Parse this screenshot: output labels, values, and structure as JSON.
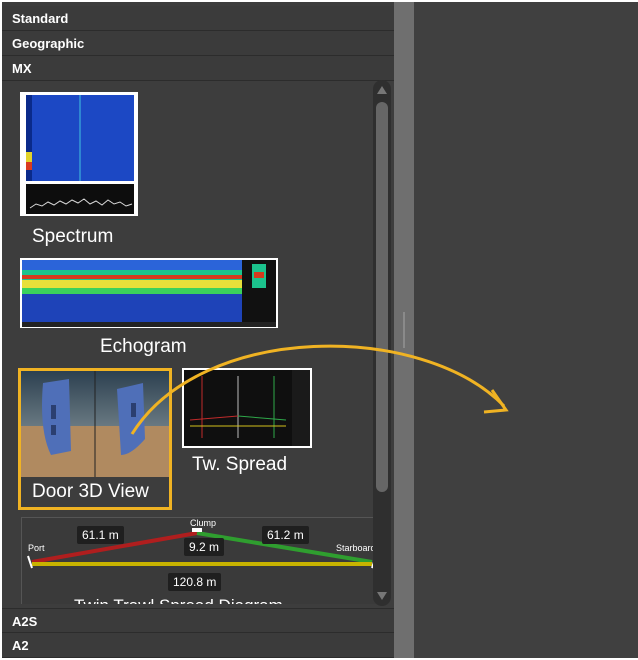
{
  "sections": {
    "standard": "Standard",
    "geographic": "Geographic",
    "mx": "MX",
    "a2s": "A2S",
    "a2": "A2"
  },
  "tiles": {
    "spectrum": "Spectrum",
    "echogram": "Echogram",
    "door3d": "Door 3D View",
    "tw_spread": "Tw. Spread",
    "twin_trawl": "Twin Trawl Spread Diagram"
  },
  "spread_diagram": {
    "port": "Port",
    "starboard": "Starboard",
    "clump": "Clump",
    "port_distance": "61.1 m",
    "starboard_distance": "61.2 m",
    "clump_distance": "9.2 m",
    "total_spread": "120.8 m"
  },
  "colors": {
    "highlight": "#f0b323",
    "port_line": "#b01e1e",
    "starboard_line": "#2f9e2f",
    "spread_line": "#c8b300"
  }
}
